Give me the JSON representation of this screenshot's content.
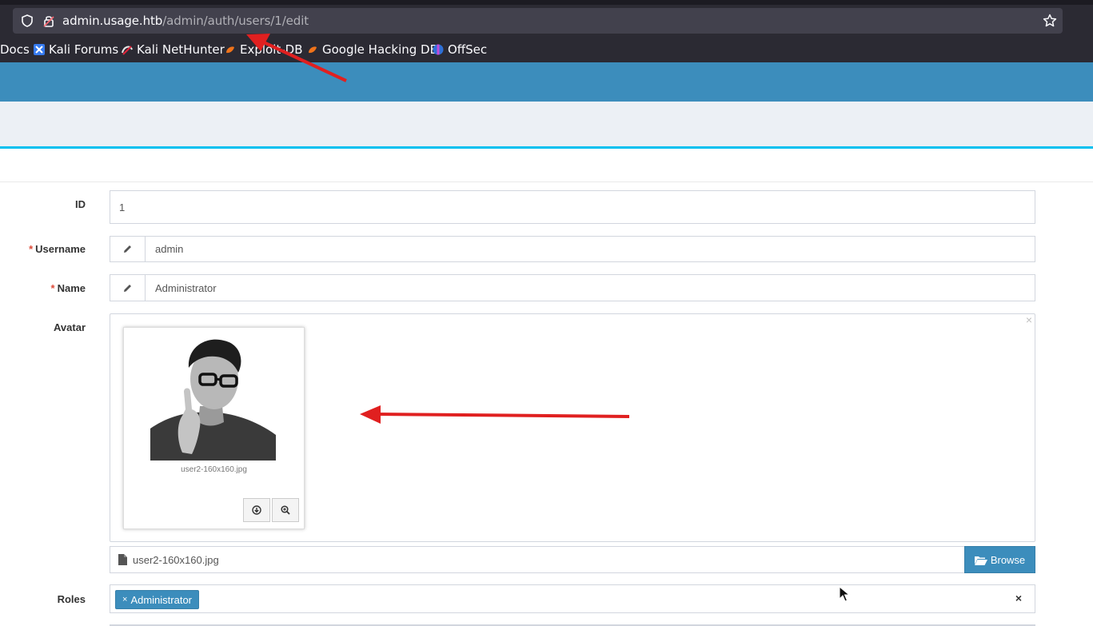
{
  "browser": {
    "url_host": "admin.usage.htb",
    "url_path": "/admin/auth/users/1/edit",
    "bookmarks": [
      {
        "label": "Docs",
        "icon": "docs-icon"
      },
      {
        "label": "Kali Forums",
        "icon": "kali-forums-icon"
      },
      {
        "label": "Kali NetHunter",
        "icon": "kali-nethunter-icon"
      },
      {
        "label": "Exploit-DB",
        "icon": "exploit-db-icon"
      },
      {
        "label": "Google Hacking DB",
        "icon": "exploit-db-icon"
      },
      {
        "label": "OffSec",
        "icon": "offsec-icon"
      }
    ]
  },
  "form": {
    "id": {
      "label": "ID",
      "value": "1"
    },
    "username": {
      "label": "Username",
      "required": "*",
      "value": "admin"
    },
    "name": {
      "label": "Name",
      "required": "*",
      "value": "Administrator"
    },
    "avatar": {
      "label": "Avatar",
      "close": "×",
      "caption": "user2-160x160.jpg",
      "file_name": "user2-160x160.jpg",
      "browse_label": "Browse"
    },
    "roles": {
      "label": "Roles",
      "tags": [
        {
          "remove": "×",
          "label": "Administrator"
        }
      ],
      "clear": "×"
    }
  },
  "colors": {
    "primary": "#3c8dbc",
    "subbar": "#ecf0f5",
    "accent_line": "#00c0ef",
    "required": "#dd4b39",
    "annotation_arrow": "#e02020"
  }
}
